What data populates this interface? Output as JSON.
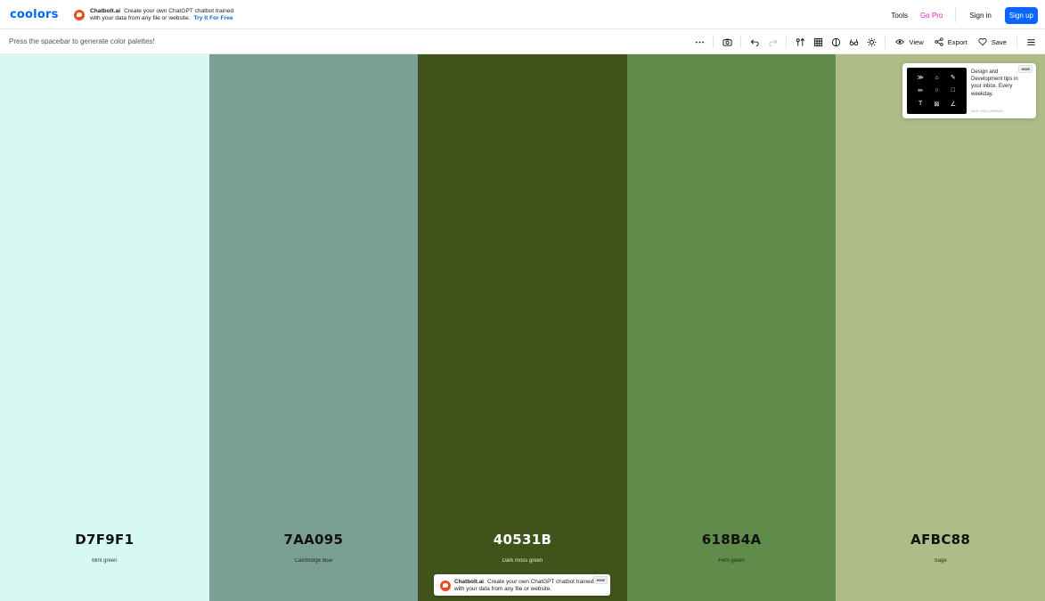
{
  "header": {
    "logo": "coolors",
    "ad": {
      "brand": "Chatbolt.ai",
      "text": "Create your own ChatGPT chatbot trained with your data from any file or website.",
      "cta": "Try It For Free"
    },
    "nav": {
      "tools": "Tools",
      "go_pro": "Go Pro",
      "sign_in": "Sign in",
      "sign_up": "Sign up"
    }
  },
  "toolbar": {
    "hint": "Press the spacebar to generate color palettes!",
    "view_label": "View",
    "export_label": "Export",
    "save_label": "Save"
  },
  "palette": [
    {
      "hex": "D7F9F1",
      "name": "Mint green",
      "color": "#D7F9F1",
      "text_color": "#111111"
    },
    {
      "hex": "7AA095",
      "name": "Cambridge blue",
      "color": "#7AA095",
      "text_color": "#111111"
    },
    {
      "hex": "40531B",
      "name": "Dark moss green",
      "color": "#40531B",
      "text_color": "#ffffff"
    },
    {
      "hex": "618B4A",
      "name": "Fern green",
      "color": "#618B4A",
      "text_color": "#111111"
    },
    {
      "hex": "AFBC88",
      "name": "Sage",
      "color": "#AFBC88",
      "text_color": "#111111"
    }
  ],
  "carbon_ad": {
    "text": "Design and Development tips in your inbox. Every weekday.",
    "via": "ADS VIA CARBON",
    "hide": "HIDE"
  },
  "bottom_ad": {
    "brand": "Chatbolt.ai",
    "text": "Create your own ChatGPT chatbot trained with your data from any file or website.",
    "hide": "HIDE"
  },
  "colors": {
    "brand_blue": "#0066ff",
    "pro_pink": "#e91ec6",
    "chatbolt_orange": "#f04a23"
  }
}
